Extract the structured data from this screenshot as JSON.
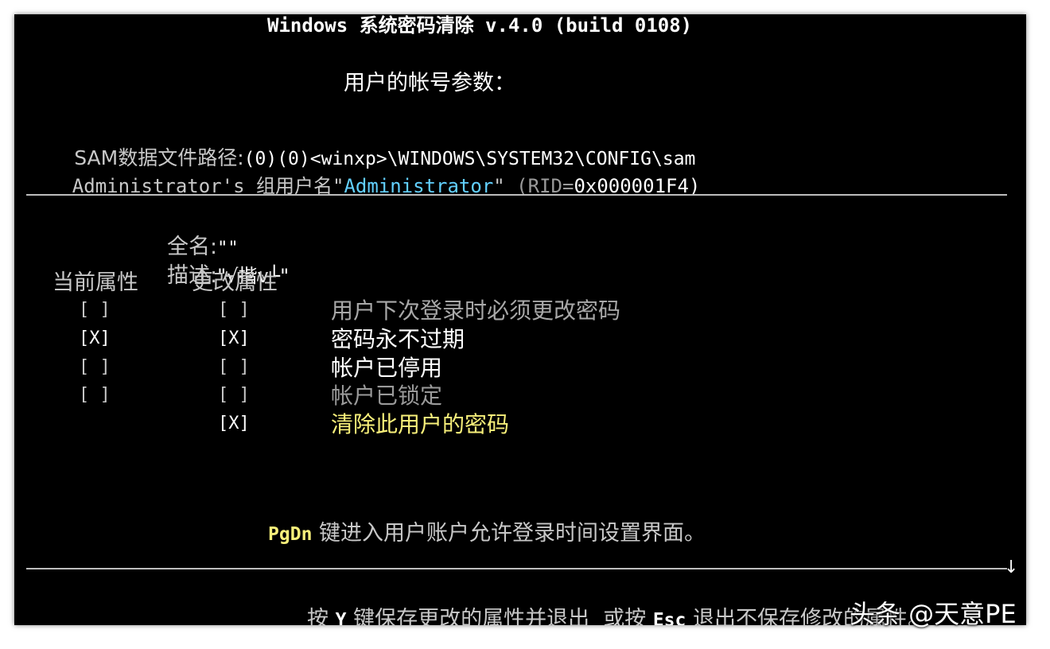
{
  "title": "Windows 系统密码清除 v.4.0 (build 0108)",
  "subtitle": "用户的帐号参数：",
  "sam_path": {
    "label": "SAM数据文件路径:",
    "value": "(0)(0)<winxp>\\WINDOWS\\SYSTEM32\\CONFIG\\sam"
  },
  "account": {
    "prefix": "Administrator's 组用户名\"",
    "username": "Administrator",
    "suffix_quote": "\"",
    "rid_open": " (RID=",
    "rid_value": "0x000001F4)"
  },
  "fullname": {
    "label": "全名:",
    "value": "\"\""
  },
  "description": {
    "label": "描述:",
    "value": "\"√揩v└\""
  },
  "columns": {
    "current": "当前属性",
    "change": "更改属性"
  },
  "attributes": [
    {
      "current": "[ ]",
      "change": "[ ]",
      "label": "用户下次登录时必须更改密码"
    },
    {
      "current": "[X]",
      "change": "[X]",
      "label": "密码永不过期"
    },
    {
      "current": "[ ]",
      "change": "[ ]",
      "label": "帐户已停用"
    },
    {
      "current": "[ ]",
      "change": "[ ]",
      "label": "帐户已锁定"
    },
    {
      "current": "",
      "change": "[X]",
      "label": "清除此用户的密码"
    }
  ],
  "hint": {
    "key": "PgDn",
    "text": " 键进入用户账户允许登录时间设置界面。"
  },
  "footer": {
    "arrow": "↓",
    "press": "按 ",
    "key_y": "Y",
    "save_text": " 键保存更改的属性并退出  或按 ",
    "key_esc": "Esc",
    "exit_text": " 退出不保存修改的属性。"
  },
  "watermark": "头条 @天意PE",
  "colors": {
    "background": "#000000",
    "text_gray": "#c8c8c8",
    "text_white": "#ffffff",
    "text_dim": "#9a9a9a",
    "accent_cyan": "#62d0ff",
    "accent_yellow": "#f8f07a"
  }
}
